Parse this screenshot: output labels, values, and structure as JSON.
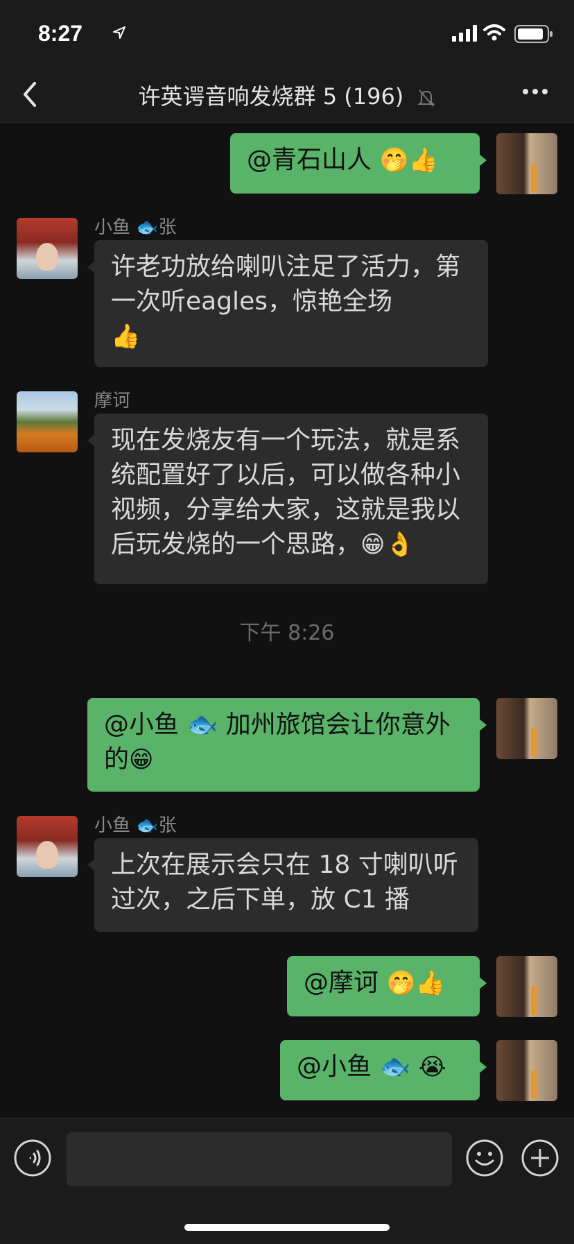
{
  "status_bar": {
    "time": "8:27"
  },
  "nav": {
    "title": "许英谔音响发烧群 5 (196)"
  },
  "messages": {
    "m1": {
      "text": "@青石山人 ",
      "emoji": "🤭👍"
    },
    "m2": {
      "sender": "小鱼 🐟张",
      "text": "许老功放给喇叭注足了活力，第一次听eagles，惊艳全场",
      "emoji": "👍"
    },
    "m3": {
      "sender": "摩诃",
      "text": "现在发烧友有一个玩法，就是系统配置好了以后，可以做各种小视频，分享给大家，这就是我以后玩发烧的一个思路，",
      "emoji": "😁👌"
    },
    "timestamp": "下午 8:26",
    "m4": {
      "text": "@小鱼 🐟 加州旅馆会让你意外的",
      "emoji": "😁"
    },
    "m5": {
      "sender": "小鱼 🐟张",
      "text": "上次在展示会只在 18 寸喇叭听过次，之后下单，放 C1 播"
    },
    "m6": {
      "text": "@摩诃 ",
      "emoji": "🤭👍"
    },
    "m7": {
      "text": "@小鱼 🐟 ",
      "emoji": "😭"
    }
  },
  "input": {
    "placeholder": ""
  },
  "colors": {
    "outgoing_bubble": "#59b469",
    "incoming_bubble": "#2c2c2c",
    "background": "#111111"
  },
  "icons": [
    "location-arrow-icon",
    "signal-icon",
    "wifi-icon",
    "battery-icon",
    "back-icon",
    "mute-bell-icon",
    "more-icon",
    "voice-icon",
    "emoji-icon",
    "plus-icon"
  ]
}
